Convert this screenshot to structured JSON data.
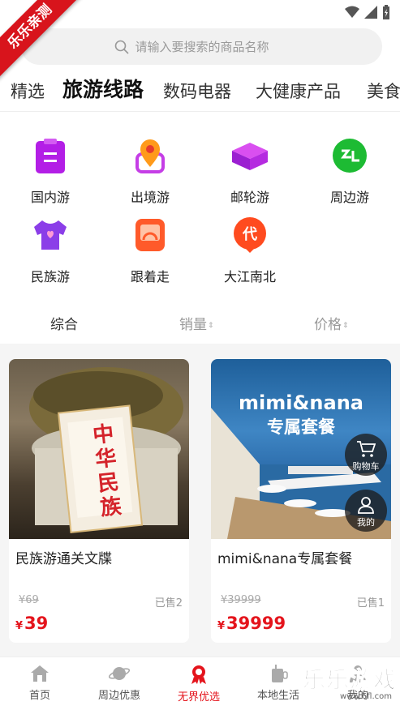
{
  "watermark": {
    "corner": "乐乐亲测",
    "bottom_text": "乐乐游戏",
    "bottom_url": "www.6fl.com"
  },
  "search": {
    "placeholder": "请输入要搜索的商品名称"
  },
  "category_tabs": [
    {
      "label": "精选",
      "active": false
    },
    {
      "label": "旅游线路",
      "active": true
    },
    {
      "label": "数码电器",
      "active": false
    },
    {
      "label": "大健康产品",
      "active": false
    },
    {
      "label": "美食",
      "active": false
    }
  ],
  "travel_categories": [
    {
      "label": "国内游",
      "icon": "clipboard-icon",
      "color": "#b31ee6"
    },
    {
      "label": "出境游",
      "icon": "map-pin-icon",
      "color": "#ff8a1f"
    },
    {
      "label": "邮轮游",
      "icon": "ship-box-icon",
      "color": "#b52be0"
    },
    {
      "label": "周边游",
      "icon": "green-circle-icon",
      "color": "#1dbb33"
    },
    {
      "label": "民族游",
      "icon": "shirt-icon",
      "color": "#8b3ee8"
    },
    {
      "label": "跟着走",
      "icon": "orange-card-icon",
      "color": "#ff5a2a"
    },
    {
      "label": "大江南北",
      "icon": "dai-badge-icon",
      "color": "#ff4b1f"
    }
  ],
  "sort": {
    "comprehensive": "综合",
    "sales": "销量",
    "price": "价格"
  },
  "products": [
    {
      "title": "民族游通关文牒",
      "original_price": "69",
      "sold": "已售2",
      "price": "39",
      "currency": "¥",
      "image_text": "中华民族"
    },
    {
      "title": "mimi&nana专属套餐",
      "original_price": "39999",
      "sold": "已售1",
      "price": "39999",
      "currency": "¥",
      "image_line1": "mimi&nana",
      "image_line2": "专属套餐"
    }
  ],
  "floating": {
    "cart": "购物车",
    "mine": "我的"
  },
  "bottom_nav": [
    {
      "label": "首页",
      "icon": "home-icon",
      "active": false
    },
    {
      "label": "周边优惠",
      "icon": "planet-icon",
      "active": false
    },
    {
      "label": "无界优选",
      "icon": "award-icon",
      "active": true
    },
    {
      "label": "本地生活",
      "icon": "drink-icon",
      "active": false
    },
    {
      "label": "我的",
      "icon": "user-icon",
      "active": false
    }
  ],
  "colors": {
    "accent": "#e4141c",
    "search_bg": "#f1f1f1",
    "feed_bg": "#f5f5f5"
  }
}
